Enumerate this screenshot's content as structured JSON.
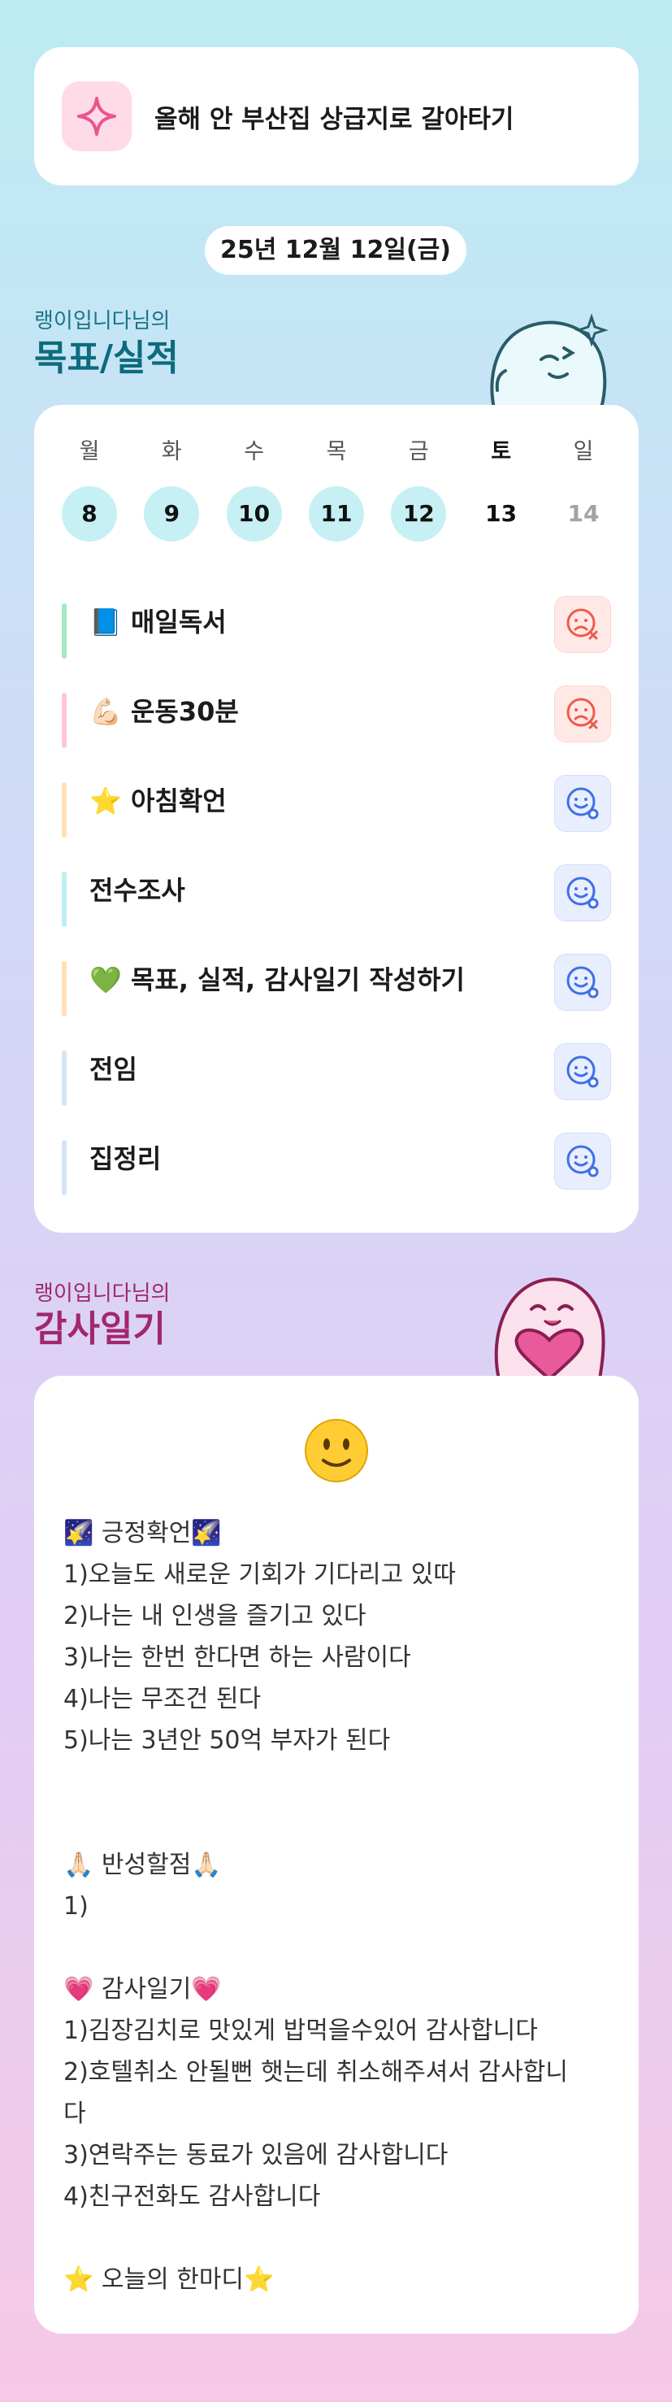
{
  "goal_banner": {
    "icon": "sparkle-icon",
    "text": "올해 안 부산집 상급지로 갈아타기"
  },
  "date": "25년 12월 12일(금)",
  "goals_section": {
    "owner": "랭이입니다님의",
    "title": "목표/실적"
  },
  "week": [
    {
      "name": "월",
      "num": "8",
      "state": "done"
    },
    {
      "name": "화",
      "num": "9",
      "state": "done"
    },
    {
      "name": "수",
      "num": "10",
      "state": "done"
    },
    {
      "name": "목",
      "num": "11",
      "state": "done"
    },
    {
      "name": "금",
      "num": "12",
      "state": "done"
    },
    {
      "name": "토",
      "num": "13",
      "state": "today"
    },
    {
      "name": "일",
      "num": "14",
      "state": "future"
    }
  ],
  "habits": [
    {
      "label": "📘 매일독서",
      "status": "fail",
      "bar_color": "#a4e8c4"
    },
    {
      "label": "💪🏻 운동30분",
      "status": "fail",
      "bar_color": "#ffc4df"
    },
    {
      "label": "⭐️ 아침확언",
      "status": "ok",
      "bar_color": "#ffe0b6"
    },
    {
      "label": "전수조사",
      "status": "ok",
      "bar_color": "#bfeef2"
    },
    {
      "label": "💚 목표, 실적, 감사일기 작성하기",
      "status": "ok",
      "bar_color": "#ffe0b6"
    },
    {
      "label": "전임",
      "status": "ok",
      "bar_color": "#d6e4f7"
    },
    {
      "label": "집정리",
      "status": "ok",
      "bar_color": "#d6e4f7"
    }
  ],
  "journal_section": {
    "owner": "랭이입니다님의",
    "title": "감사일기"
  },
  "journal": {
    "mood_icon": "slightly-smiling-face-icon",
    "mood_emoji": "🙂",
    "lines": [
      "🌠 긍정확언🌠",
      "1)오늘도 새로운 기회가 기다리고 있따",
      "2)나는 내 인생을 즐기고 있다",
      "3)나는 한번 한다면 하는 사람이다",
      "4)나는 무조건 된다",
      "5)나는 3년안 50억 부자가 된다",
      "",
      "",
      "🙏🏻 반성할점🙏🏻",
      "1)",
      "",
      "💗 감사일기💗",
      "1)김장김치로 맛있게 밥먹을수있어 감사합니다",
      "2)호텔취소 안될뻔 햇는데 취소해주셔서 감사합니",
      "다",
      "3)연락주는 동료가 있음에 감사합니다",
      "4)친구전화도 감사합니다",
      "",
      "⭐️ 오늘의 한마디⭐️"
    ]
  },
  "colors": {
    "title_goals": "#0d6b7c",
    "title_journal": "#a2276d",
    "fail_icon": "#ef5a4c",
    "ok_icon": "#3f6fe6"
  }
}
